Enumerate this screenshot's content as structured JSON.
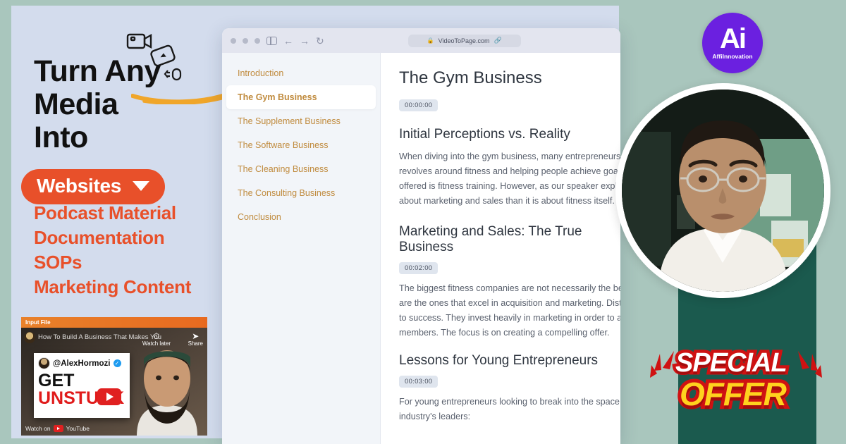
{
  "theme": {
    "page_bg": "#a9c6bd",
    "panel_bg": "#d3dced",
    "accent_orange": "#e8502a",
    "teal": "#1b5a4e",
    "logo_purple": "#6b20e0",
    "nav_gold": "#c08b3e",
    "offer_red": "#cf1212",
    "offer_yellow": "#ffd21e"
  },
  "promo": {
    "headline_lines": [
      "Turn Any",
      "Media",
      "Into"
    ],
    "pill_label": "Websites",
    "features": [
      "Podcast Material",
      "Documentation",
      "SOPs",
      "Marketing Content"
    ],
    "icons": [
      "video-camera-icon",
      "media-card-icon",
      "microphone-icon"
    ]
  },
  "video_card": {
    "badge": "Input File",
    "title": "How To Build A Business That Makes You",
    "watch_later": "Watch later",
    "share": "Share",
    "handle": "@AlexHormozi",
    "verified_glyph": "✓",
    "line1": "GET",
    "line2": "UNSTUCK",
    "footer": "Watch on",
    "footer_brand": "YouTube"
  },
  "browser": {
    "url": "VideoToPage.com",
    "lock_icon": "lock-icon",
    "link_icon": "link-icon",
    "back_glyph": "←",
    "forward_glyph": "→",
    "reload_glyph": "↻",
    "sidebar_toggle": "sidebar-toggle-icon"
  },
  "doc_sidebar": {
    "items": [
      {
        "label": "Introduction",
        "active": false
      },
      {
        "label": "The Gym Business",
        "active": true
      },
      {
        "label": "The Supplement Business",
        "active": false
      },
      {
        "label": "The Software Business",
        "active": false
      },
      {
        "label": "The Cleaning Business",
        "active": false
      },
      {
        "label": "The Consulting Business",
        "active": false
      },
      {
        "label": "Conclusion",
        "active": false
      }
    ]
  },
  "doc": {
    "title": "The Gym Business",
    "title_timestamp": "00:00:00",
    "sections": [
      {
        "heading": "Initial Perceptions vs. Reality",
        "timestamp": "",
        "body": "When diving into the gym business, many entrepreneurs assume it revolves around fitness and helping people achieve goals, and that what is offered is fitness training. However, as our speaker explains, it is far more about marketing and sales than it is about fitness itself."
      },
      {
        "heading": "Marketing and Sales: The True Business",
        "timestamp": "00:02:00",
        "body": "The biggest fitness companies are not necessarily the best at training; they are the ones that excel in acquisition and marketing. Distribution is the key to success. They invest heavily in marketing in order to attract new members. The focus is on creating a compelling offer."
      },
      {
        "heading": "Lessons for Young Entrepreneurs",
        "timestamp": "00:03:00",
        "body": "For young entrepreneurs looking to break into the space, here is what the industry's leaders:"
      }
    ]
  },
  "logo": {
    "mark": "Ai",
    "name": "AffiInnovation"
  },
  "offer": {
    "line1": "SPECIAL",
    "line2": "OFFER"
  },
  "avatar": {
    "name": "presenter-photo"
  }
}
